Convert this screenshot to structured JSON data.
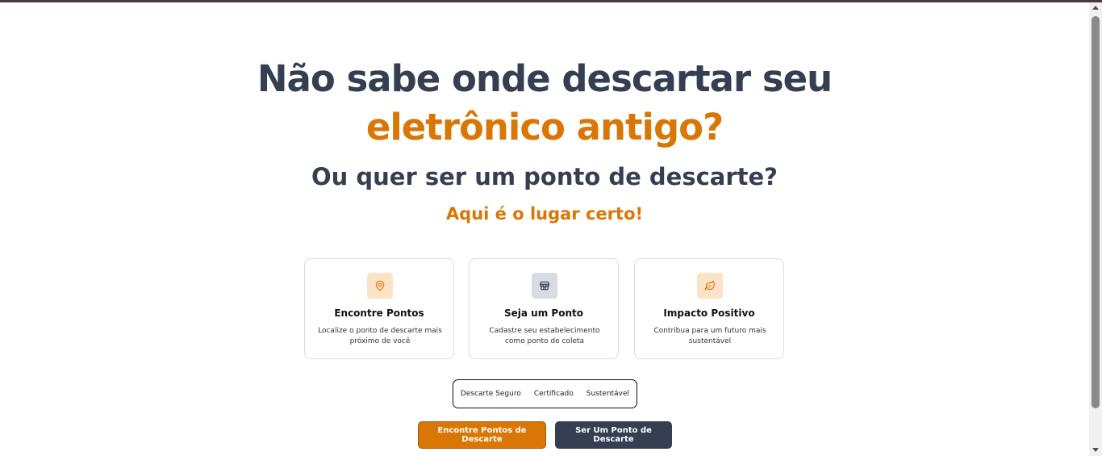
{
  "hero": {
    "headline_line1": "Não sabe onde descartar seu",
    "headline_line2": "eletrônico antigo?",
    "subheadline": "Ou quer ser um ponto de descarte?",
    "tagline": "Aqui é o lugar certo!"
  },
  "features": [
    {
      "icon": "map-pin-icon",
      "title": "Encontre Pontos",
      "description": "Localize o ponto de descarte mais próximo de você"
    },
    {
      "icon": "store-icon",
      "title": "Seja um Ponto",
      "description": "Cadastre seu estabelecimento como ponto de coleta"
    },
    {
      "icon": "leaf-icon",
      "title": "Impacto Positivo",
      "description": "Contribua para um futuro mais sustentável"
    }
  ],
  "badges": [
    "Descarte Seguro",
    "Certificado",
    "Sustentável"
  ],
  "actions": {
    "find_points_label": "Encontre Pontos de Descarte",
    "become_point_label": "Ser Um Ponto de Descarte"
  },
  "colors": {
    "accent": "#d97706",
    "primary_text": "#363f52",
    "secondary_button": "#363f52"
  }
}
